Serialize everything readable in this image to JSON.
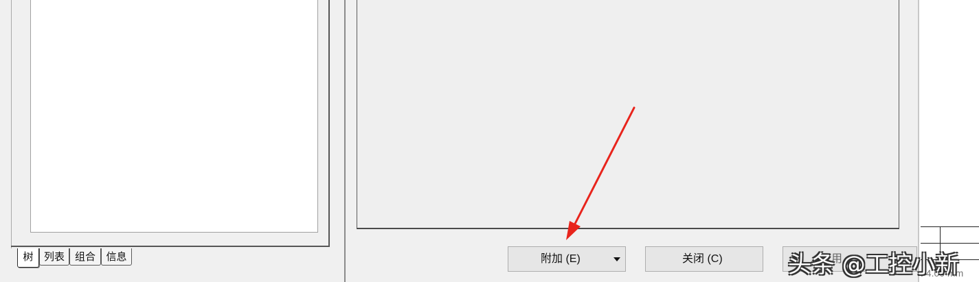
{
  "left_panel": {
    "tabs": [
      {
        "label": "树",
        "active": true
      },
      {
        "label": "列表",
        "active": false
      },
      {
        "label": "组合",
        "active": false
      },
      {
        "label": "信息",
        "active": false
      }
    ]
  },
  "buttons": {
    "attach_label": "附加 (E)",
    "close_label": "关闭 (C)",
    "third_label": "用"
  },
  "right_strip": {
    "scale_text": ": 4.00 mm"
  },
  "watermark": {
    "text": "头条 @工控小新"
  },
  "annotation": {
    "arrow_color": "#e8241c"
  }
}
